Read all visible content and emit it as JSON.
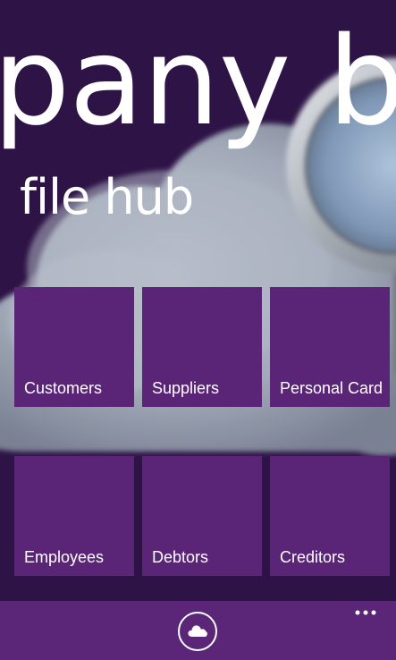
{
  "panorama": {
    "title": "pany br"
  },
  "section": {
    "title": "file hub"
  },
  "tiles": [
    {
      "label": "Customers"
    },
    {
      "label": "Suppliers"
    },
    {
      "label": "Personal Card"
    },
    {
      "label": "Employees"
    },
    {
      "label": "Debtors"
    },
    {
      "label": "Creditors"
    }
  ],
  "app_bar": {
    "button_icon": "cloud-icon",
    "more_icon": "ellipsis-icon"
  },
  "colors": {
    "background": "#2e1446",
    "accent": "#5b2577",
    "app_bar": "#5b2578",
    "text": "#ffffff"
  }
}
